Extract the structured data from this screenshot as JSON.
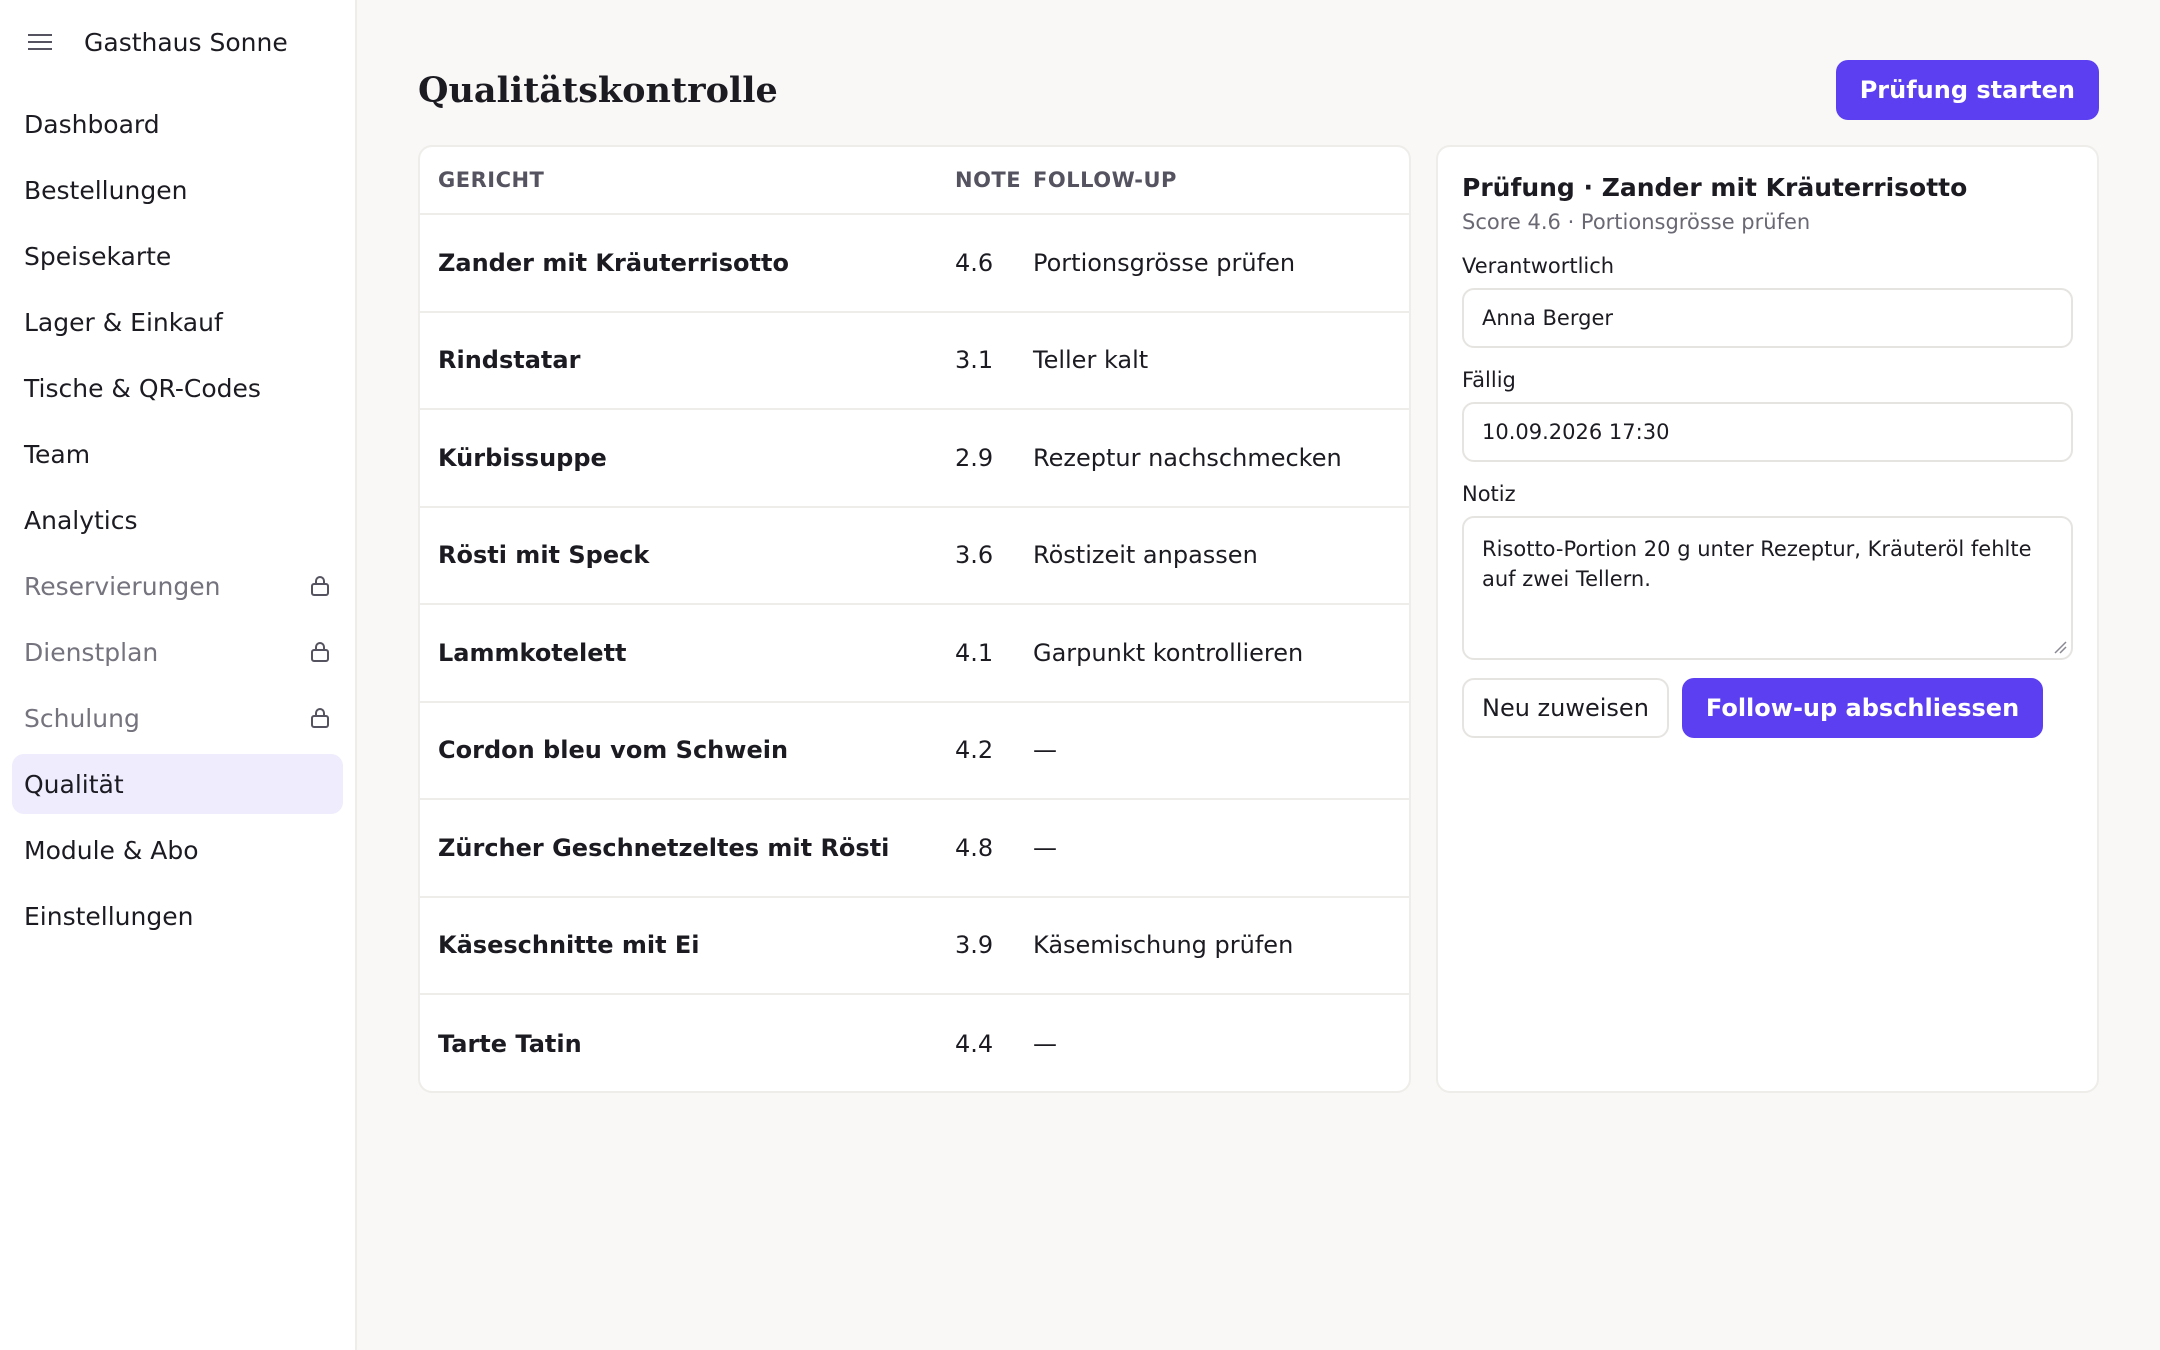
{
  "app": {
    "name": "Gasthaus Sonne",
    "accent_color": "#5b3ff0",
    "active_highlight_color": "#eeecfd"
  },
  "sidebar": {
    "items": [
      {
        "label": "Dashboard",
        "locked": false,
        "active": false
      },
      {
        "label": "Bestellungen",
        "locked": false,
        "active": false
      },
      {
        "label": "Speisekarte",
        "locked": false,
        "active": false
      },
      {
        "label": "Lager & Einkauf",
        "locked": false,
        "active": false
      },
      {
        "label": "Tische & QR-Codes",
        "locked": false,
        "active": false
      },
      {
        "label": "Team",
        "locked": false,
        "active": false
      },
      {
        "label": "Analytics",
        "locked": false,
        "active": false
      },
      {
        "label": "Reservierungen",
        "locked": true,
        "active": false
      },
      {
        "label": "Dienstplan",
        "locked": true,
        "active": false
      },
      {
        "label": "Schulung",
        "locked": true,
        "active": false
      },
      {
        "label": "Qualität",
        "locked": false,
        "active": true
      },
      {
        "label": "Module & Abo",
        "locked": false,
        "active": false
      },
      {
        "label": "Einstellungen",
        "locked": false,
        "active": false
      }
    ]
  },
  "header": {
    "title": "Qualitätskontrolle",
    "start_button": "Prüfung starten"
  },
  "table": {
    "columns": {
      "dish": "GERICHT",
      "note": "NOTE",
      "follow_up": "FOLLOW-UP"
    },
    "rows": [
      {
        "dish": "Zander mit Kräuterrisotto",
        "note": "4.6",
        "follow_up": "Portionsgrösse prüfen"
      },
      {
        "dish": "Rindstatar",
        "note": "3.1",
        "follow_up": "Teller kalt"
      },
      {
        "dish": "Kürbissuppe",
        "note": "2.9",
        "follow_up": "Rezeptur nachschmecken"
      },
      {
        "dish": "Rösti mit Speck",
        "note": "3.6",
        "follow_up": "Röstizeit anpassen"
      },
      {
        "dish": "Lammkotelett",
        "note": "4.1",
        "follow_up": "Garpunkt kontrollieren"
      },
      {
        "dish": "Cordon bleu vom Schwein",
        "note": "4.2",
        "follow_up": "—"
      },
      {
        "dish": "Zürcher Geschnetzeltes mit Rösti",
        "note": "4.8",
        "follow_up": "—"
      },
      {
        "dish": "Käseschnitte mit Ei",
        "note": "3.9",
        "follow_up": "Käsemischung prüfen"
      },
      {
        "dish": "Tarte Tatin",
        "note": "4.4",
        "follow_up": "—"
      }
    ]
  },
  "detail": {
    "title": "Prüfung · Zander mit Kräuterrisotto",
    "subtitle": "Score 4.6 · Portionsgrösse prüfen",
    "owner_label": "Verantwortlich",
    "owner_value": "Anna Berger",
    "due_label": "Fällig",
    "due_value": "10.09.2026 17:30",
    "note_label": "Notiz",
    "note_value": "Risotto-Portion 20 g unter Rezeptur, Kräuteröl fehlte auf zwei Tellern.",
    "reassign_button": "Neu zuweisen",
    "complete_button": "Follow-up abschliessen"
  },
  "icons": {
    "menu": "hamburger-menu-icon",
    "locked": "lock-icon"
  }
}
